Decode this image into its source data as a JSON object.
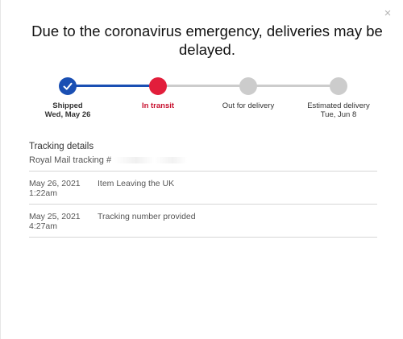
{
  "modal": {
    "close_glyph": "×",
    "headline": "Due to the coronavirus emergency, deliveries may be delayed."
  },
  "progress": {
    "colors": {
      "done": "#1a4fb3",
      "current": "#e21e3b",
      "pending": "#cccccc",
      "current_text": "#c8102e"
    },
    "steps": [
      {
        "label": "Shipped",
        "sublabel": "Wed, May 26",
        "state": "done",
        "icon": "check-icon"
      },
      {
        "label": "In transit",
        "sublabel": "",
        "state": "current",
        "icon": ""
      },
      {
        "label": "Out for delivery",
        "sublabel": "",
        "state": "pending",
        "icon": ""
      },
      {
        "label": "Estimated delivery",
        "sublabel": "Tue, Jun 8",
        "state": "pending",
        "icon": ""
      }
    ]
  },
  "tracking": {
    "title": "Tracking details",
    "carrier_label": "Royal Mail tracking #",
    "events": [
      {
        "date": "May 26, 2021",
        "time": "1:22am",
        "description": "Item Leaving the UK"
      },
      {
        "date": "May 25, 2021",
        "time": "4:27am",
        "description": "Tracking number provided"
      }
    ]
  }
}
